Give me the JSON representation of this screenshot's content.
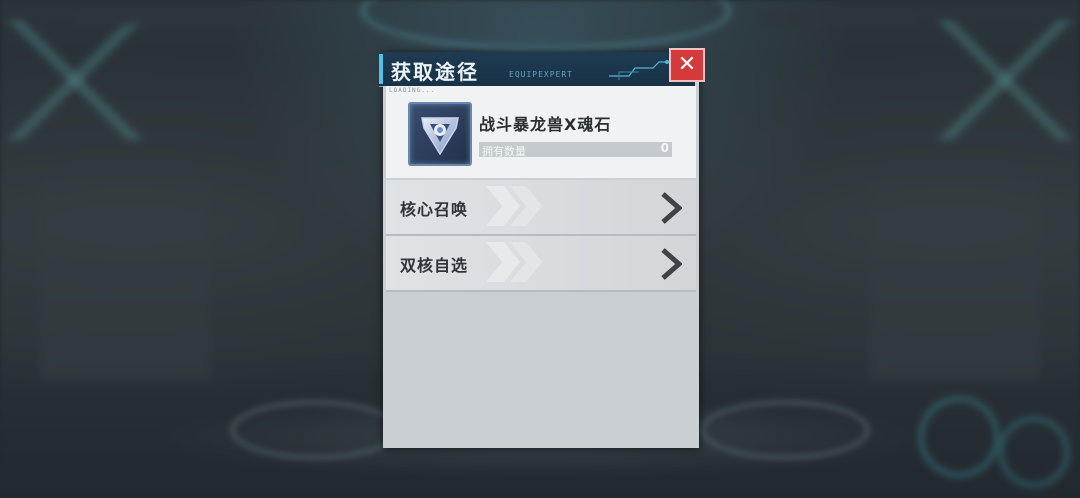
{
  "dialog": {
    "title": "获取途径",
    "title_deco": "EQUIPEXPERT",
    "loading_text": "LOADING...",
    "close_icon": "close-icon"
  },
  "item": {
    "name": "战斗暴龙兽X魂石",
    "owned_label": "拥有数量",
    "owned_count": "0",
    "icon": "soul-stone-icon"
  },
  "routes": [
    {
      "label": "核心召唤",
      "icon": "chevron-right-icon"
    },
    {
      "label": "双核自选",
      "icon": "chevron-right-icon"
    }
  ],
  "colors": {
    "title_bar": "#1e3b52",
    "accent": "#4fc3e6",
    "close": "#d53a3a",
    "panel": "#c9cfd2"
  }
}
